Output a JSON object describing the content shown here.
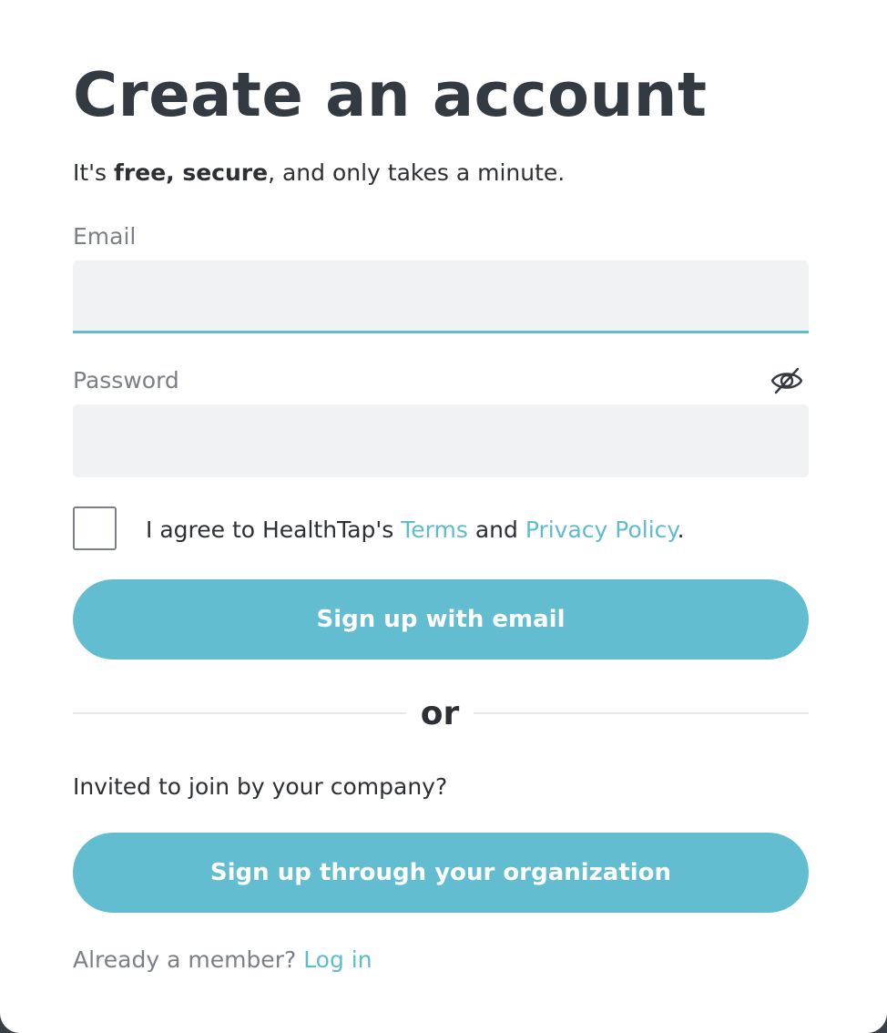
{
  "header": {
    "title": "Create an account",
    "subtitle_prefix": "It's ",
    "subtitle_bold": "free, secure",
    "subtitle_suffix": ", and only takes a minute."
  },
  "form": {
    "email_label": "Email",
    "email_value": "",
    "password_label": "Password",
    "password_value": "",
    "password_toggle_icon": "eye-slash-icon",
    "agree_checked": false,
    "agree_prefix": "I agree to HealthTap's ",
    "terms_link": "Terms",
    "agree_and": " and ",
    "privacy_link": "Privacy Policy",
    "agree_suffix": ".",
    "signup_email_label": "Sign up with email"
  },
  "divider": {
    "label": "or"
  },
  "organization": {
    "prompt": "Invited to join by your company?",
    "signup_org_label": "Sign up through your organization"
  },
  "footer": {
    "member_prompt": "Already a member? ",
    "login_link": "Log in"
  },
  "colors": {
    "accent": "#5fbccf",
    "button": "#62bdd0",
    "title": "#343a41",
    "muted": "#7b8087",
    "input_bg": "#f1f2f4"
  }
}
